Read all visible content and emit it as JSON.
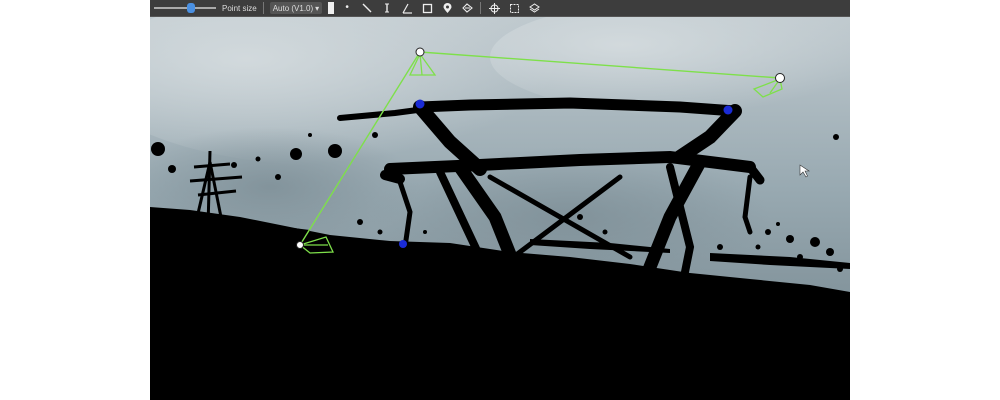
{
  "toolbar": {
    "point_size_label": "Point size",
    "color_mode_value": "Auto (V1.0)"
  },
  "colors": {
    "toolbar_bg": "#3d3d3d",
    "camera_path": "#7ee04a",
    "anchor_point": "#1a2bd6",
    "camera_node": "#ffffff"
  },
  "icons": [
    "point-icon",
    "line-measure-icon",
    "height-measure-icon",
    "angle-measure-icon",
    "area-measure-icon",
    "marker-icon",
    "clear-measure-icon",
    "fit-view-icon",
    "bounding-box-icon",
    "layers-icon",
    "cursor-icon"
  ]
}
